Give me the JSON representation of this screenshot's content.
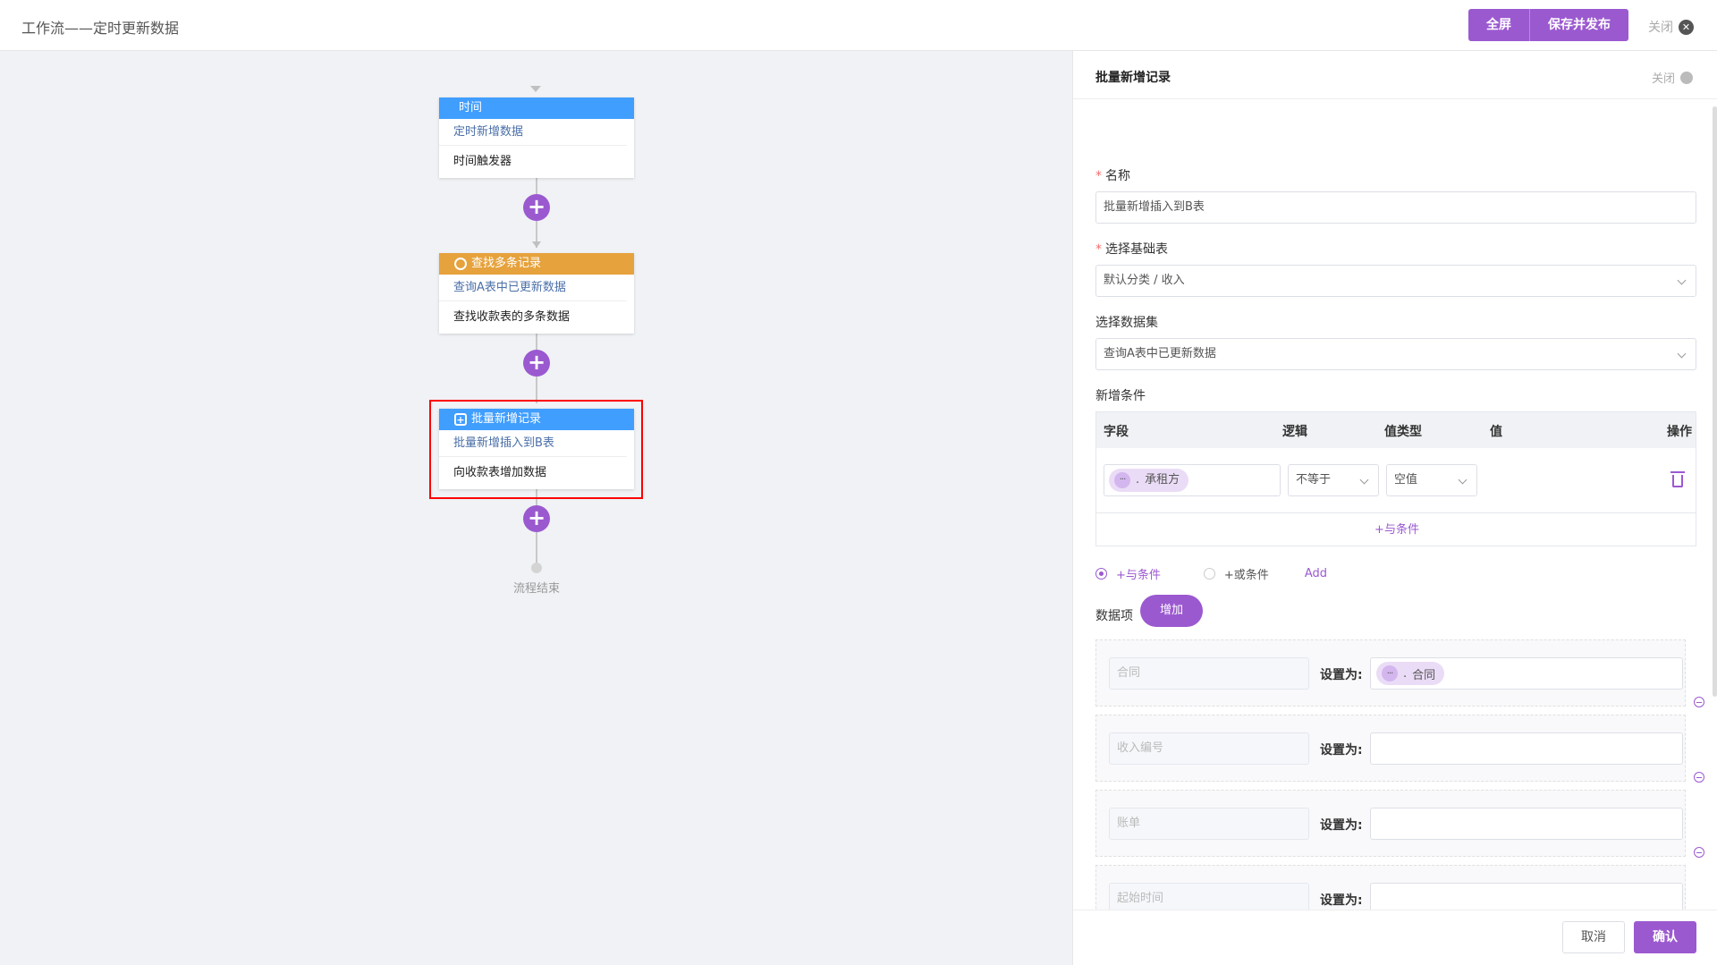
{
  "header": {
    "title": "工作流——定时更新数据",
    "fullscreen_label": "全屏",
    "save_publish_label": "保存并发布",
    "close_label": "关闭"
  },
  "flow": {
    "nodes": [
      {
        "type": "时间",
        "name": "定时新增数据",
        "desc": "时间触发器",
        "color": "#409eff",
        "icon": "none"
      },
      {
        "type": "查找多条记录",
        "name": "查询A表中已更新数据",
        "desc": "查找收款表的多条数据",
        "color": "#e6a23c",
        "icon": "search-icon"
      },
      {
        "type": "批量新增记录",
        "name": "批量新增插入到B表",
        "desc": "向收款表增加数据",
        "color": "#409eff",
        "icon": "add-record-icon"
      }
    ],
    "end_label": "流程结束",
    "selected_node_index": 2,
    "accent": "#9b59d0"
  },
  "panel": {
    "title": "批量新增记录",
    "close_label": "关闭",
    "name_label": "名称",
    "name_value": "批量新增插入到B表",
    "base_table_label": "选择基础表",
    "base_table_value": "默认分类 / 收入",
    "dataset_label": "选择数据集",
    "dataset_value": "查询A表中已更新数据",
    "conditions_label": "新增条件",
    "conditions_table": {
      "headers": [
        "字段",
        "逻辑",
        "值类型",
        "值",
        "操作"
      ],
      "rows": [
        {
          "field_tag_dots": "···",
          "field_tag_sep": ".",
          "field_tag_label": "承租方",
          "logic": "不等于",
          "value_type": "空值",
          "value": ""
        }
      ],
      "add_and_label": "+与条件"
    },
    "radio_and_label": "+与条件",
    "radio_or_label": "+或条件",
    "radio_selected": "and",
    "add_link": "Add",
    "data_items_label": "数据项",
    "add_button_label": "增加",
    "data_items": [
      {
        "field": "合同",
        "set_label": "设置为:",
        "value_tag": "合同",
        "value_tag_dots": "···",
        "value_tag_sep": "."
      },
      {
        "field": "收入编号",
        "set_label": "设置为:",
        "value_tag": ""
      },
      {
        "field": "账单",
        "set_label": "设置为:",
        "value_tag": ""
      },
      {
        "field": "起始时间",
        "set_label": "设置为:",
        "value_tag": ""
      }
    ],
    "cancel_label": "取消",
    "confirm_label": "确认"
  }
}
